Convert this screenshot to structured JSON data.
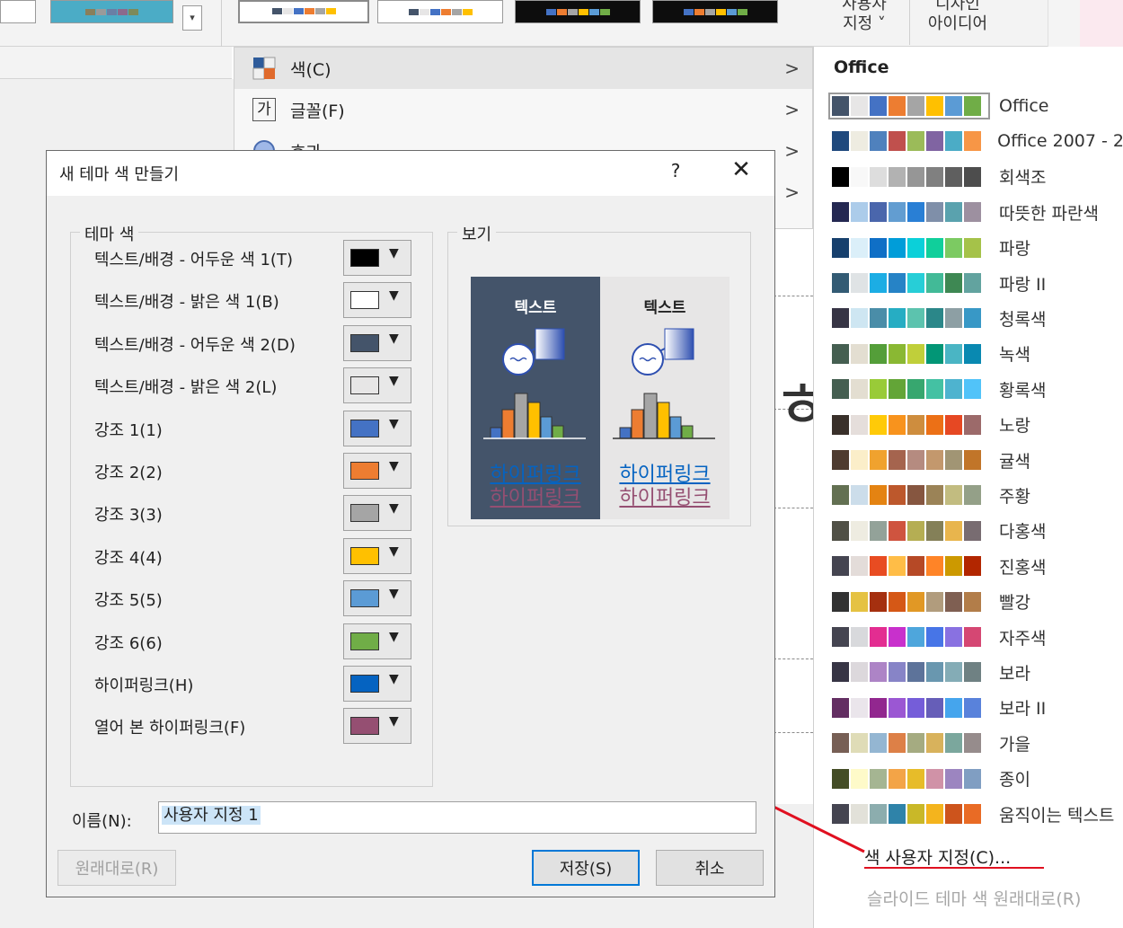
{
  "ribbon": {
    "variants": [
      {
        "colors": [
          "#44546a",
          "#e7e6e6",
          "#4472c4",
          "#ed7d31",
          "#a5a5a5",
          "#ffc000",
          "#5b9bd5",
          "#70ad47"
        ]
      },
      {
        "colors": [
          "#44546a",
          "#e7e6e6",
          "#4472c4",
          "#ed7d31",
          "#a5a5a5",
          "#ffc000",
          "#5b9bd5",
          "#70ad47"
        ]
      },
      {
        "colors": [
          "#44546a",
          "#e7e6e6",
          "#4472c4",
          "#ed7d31",
          "#a5a5a5",
          "#ffc000",
          "#5b9bd5",
          "#70ad47"
        ]
      },
      {
        "colors": [
          "#4472c4",
          "#ed7d31",
          "#a5a5a5",
          "#ffc000",
          "#5b9bd5",
          "#70ad47",
          "#264478",
          "#9e480e"
        ]
      },
      {
        "colors": [
          "#4472c4",
          "#ed7d31",
          "#a5a5a5",
          "#ffc000",
          "#5b9bd5",
          "#70ad47",
          "#264478",
          "#9e480e"
        ]
      }
    ],
    "customize_button": "사용자\n지정 ˅",
    "design_ideas_button": "디자인\n아이디어"
  },
  "design_menu": {
    "items": [
      {
        "label": "색(C)",
        "icon": "color-squares-icon",
        "arrow": ">"
      },
      {
        "label": "글꼴(F)",
        "icon": "font-ga-icon",
        "arrow": ">"
      },
      {
        "label": "효과",
        "icon": "effects-circle-icon",
        "arrow": ">"
      },
      {
        "label": "",
        "icon": "",
        "arrow": ">"
      }
    ]
  },
  "dialog": {
    "title": "새 테마 색 만들기",
    "help": "?",
    "close": "✕",
    "theme_colors_group": "테마 색",
    "preview_group": "보기",
    "colors": [
      {
        "label": "텍스트/배경 - 어두운 색 1(T)",
        "color": "#000000"
      },
      {
        "label": "텍스트/배경 - 밝은 색 1(B)",
        "color": "#ffffff"
      },
      {
        "label": "텍스트/배경 - 어두운 색 2(D)",
        "color": "#44546a"
      },
      {
        "label": "텍스트/배경 - 밝은 색 2(L)",
        "color": "#e7e6e6"
      },
      {
        "label": "강조 1(1)",
        "color": "#4472c4"
      },
      {
        "label": "강조 2(2)",
        "color": "#ed7d31"
      },
      {
        "label": "강조 3(3)",
        "color": "#a5a5a5"
      },
      {
        "label": "강조 4(4)",
        "color": "#ffc000"
      },
      {
        "label": "강조 5(5)",
        "color": "#5b9bd5"
      },
      {
        "label": "강조 6(6)",
        "color": "#70ad47"
      },
      {
        "label": "하이퍼링크(H)",
        "color": "#0563c1"
      },
      {
        "label": "열어 본 하이퍼링크(F)",
        "color": "#954f72"
      }
    ],
    "preview": {
      "dark_text": "텍스트",
      "light_text": "텍스트",
      "hyperlink": "하이퍼링크",
      "visited_hyperlink": "하이퍼링크",
      "dark_bg": "#44546a",
      "light_bg": "#e7e6e6"
    },
    "name_label": "이름(N):",
    "name_value": "사용자 지정 1",
    "reset_button": "원래대로(R)",
    "save_button": "저장(S)",
    "cancel_button": "취소"
  },
  "palette_menu": {
    "header": "Office",
    "themes": [
      {
        "name": "Office",
        "colors": [
          "#44546a",
          "#e7e6e6",
          "#4472c4",
          "#ed7d31",
          "#a5a5a5",
          "#ffc000",
          "#5b9bd5",
          "#70ad47"
        ],
        "selected": true
      },
      {
        "name": "Office 2007 - 2",
        "colors": [
          "#1f497d",
          "#eeece1",
          "#4f81bd",
          "#c0504d",
          "#9bbb59",
          "#8064a2",
          "#4bacc6",
          "#f79646"
        ]
      },
      {
        "name": "회색조",
        "colors": [
          "#000000",
          "#f8f8f8",
          "#dddddd",
          "#b2b2b2",
          "#969696",
          "#808080",
          "#5f5f5f",
          "#4d4d4d"
        ]
      },
      {
        "name": "따뜻한 파란색",
        "colors": [
          "#242852",
          "#acccea",
          "#4a66ac",
          "#629dd1",
          "#297fd5",
          "#7f8fa9",
          "#5aa2ae",
          "#9d90a0"
        ]
      },
      {
        "name": "파랑",
        "colors": [
          "#17406d",
          "#dbeff9",
          "#0f6fc6",
          "#009dd9",
          "#0bd0d9",
          "#10cf9b",
          "#7cca62",
          "#a5c249"
        ]
      },
      {
        "name": "파랑 II",
        "colors": [
          "#335b74",
          "#dfe3e5",
          "#1cade4",
          "#2683c6",
          "#27ced7",
          "#42ba97",
          "#3e8853",
          "#62a39f"
        ]
      },
      {
        "name": "청록색",
        "colors": [
          "#373545",
          "#cee6f2",
          "#4a8da8",
          "#26adc3",
          "#5cc3ae",
          "#2b8789",
          "#8d9fa4",
          "#3898c6"
        ]
      },
      {
        "name": "녹색",
        "colors": [
          "#455f51",
          "#e3ded1",
          "#549e39",
          "#8ab833",
          "#c0cf3a",
          "#029676",
          "#4ab5c4",
          "#0989b1"
        ]
      },
      {
        "name": "황록색",
        "colors": [
          "#455f51",
          "#e3ded1",
          "#99cb38",
          "#63a537",
          "#37a76f",
          "#44c1a3",
          "#4eb3cf",
          "#51c3f9"
        ]
      },
      {
        "name": "노랑",
        "colors": [
          "#39302a",
          "#e5dedb",
          "#ffca08",
          "#f8931d",
          "#ce8d3e",
          "#ec7016",
          "#e64823",
          "#9c6a6a"
        ]
      },
      {
        "name": "귤색",
        "colors": [
          "#4e3b30",
          "#fbeec9",
          "#f0a22e",
          "#a5644e",
          "#b58b80",
          "#c3986d",
          "#a19574",
          "#c17529"
        ]
      },
      {
        "name": "주황",
        "colors": [
          "#637052",
          "#ccddea",
          "#e48312",
          "#bd582c",
          "#865640",
          "#9b8357",
          "#c2bc80",
          "#94a088"
        ]
      },
      {
        "name": "다홍색",
        "colors": [
          "#505046",
          "#eeece1",
          "#93a299",
          "#cf543f",
          "#b5ae53",
          "#848058",
          "#e8b54d",
          "#786c71"
        ]
      },
      {
        "name": "진홍색",
        "colors": [
          "#454551",
          "#e3dcd9",
          "#e84c22",
          "#ffbd47",
          "#b64926",
          "#ff8427",
          "#cc9900",
          "#b22600"
        ]
      },
      {
        "name": "빨강",
        "colors": [
          "#323232",
          "#e5c243",
          "#a5300f",
          "#d55816",
          "#e19825",
          "#b19c7d",
          "#7f5f52",
          "#b27d49"
        ]
      },
      {
        "name": "자주색",
        "colors": [
          "#454551",
          "#d8d9dc",
          "#e32d91",
          "#c830cc",
          "#4ea6dc",
          "#4775e7",
          "#8971e1",
          "#d54773"
        ]
      },
      {
        "name": "보라",
        "colors": [
          "#373545",
          "#dcd8dc",
          "#ad84c6",
          "#8784c7",
          "#5d739a",
          "#6997af",
          "#84acb6",
          "#6f8183"
        ]
      },
      {
        "name": "보라 II",
        "colors": [
          "#632e62",
          "#eae5eb",
          "#92278f",
          "#9b57d3",
          "#755dd9",
          "#665eb8",
          "#45a5ed",
          "#5982db"
        ]
      },
      {
        "name": "가을",
        "colors": [
          "#775f55",
          "#dfdcb7",
          "#94b6d2",
          "#dd8047",
          "#a5ab81",
          "#d8b25c",
          "#7ba79d",
          "#968c8c"
        ]
      },
      {
        "name": "종이",
        "colors": [
          "#444d26",
          "#fefac9",
          "#a5b592",
          "#f3a447",
          "#e7bc29",
          "#d092a7",
          "#9c85c0",
          "#809ec2"
        ]
      },
      {
        "name": "움직이는 텍스트",
        "colors": [
          "#454551",
          "#e2e1d9",
          "#8cadae",
          "#2f83a9",
          "#c9b828",
          "#f4b41d",
          "#cd541c",
          "#e96b25"
        ]
      }
    ],
    "customize_link": "색 사용자 지정(C)...",
    "reset_link": "슬라이드 테마 색 원래대로(R)"
  },
  "annotation": {
    "arrow_color": "#e01020"
  }
}
